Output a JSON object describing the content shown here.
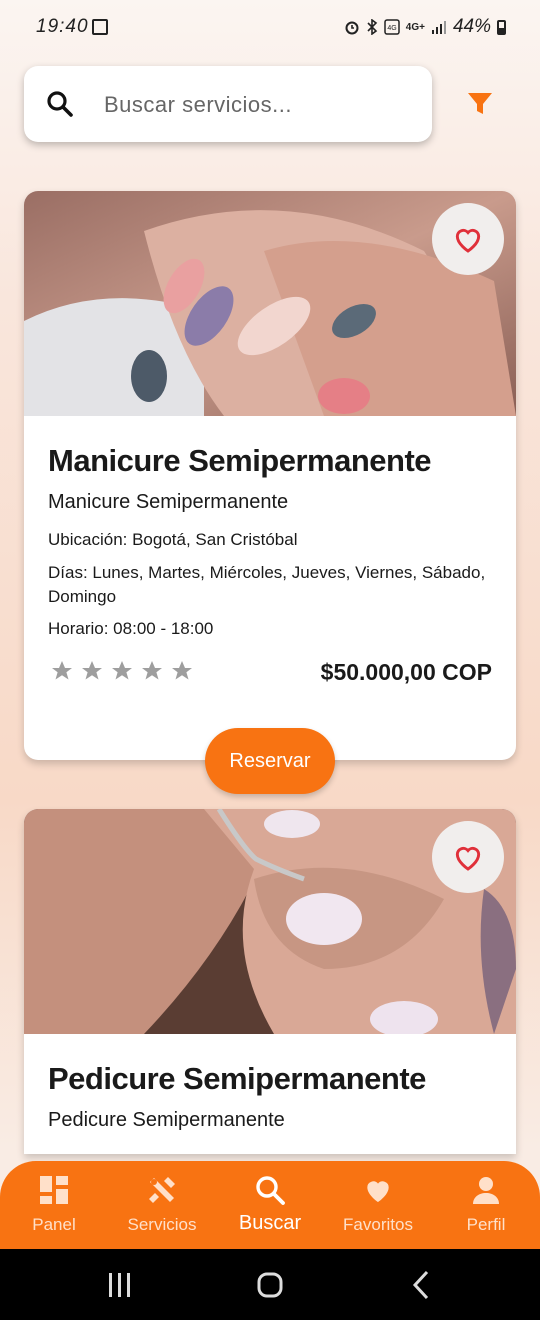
{
  "status_bar": {
    "time": "19:40",
    "network": "4G+",
    "battery": "44%"
  },
  "search": {
    "placeholder": "Buscar servicios..."
  },
  "colors": {
    "accent": "#f87312",
    "heart": "#e0303a",
    "star": "#9e9e9e"
  },
  "services": [
    {
      "title": "Manicure Semipermanente",
      "subtitle": "Manicure Semipermanente",
      "location": "Ubicación: Bogotá, San Cristóbal",
      "days": "Días: Lunes, Martes, Miércoles, Jueves, Viernes, Sábado, Domingo",
      "hours": "Horario: 08:00 - 18:00",
      "rating": 0,
      "price": "$50.000,00 COP",
      "reserve_label": "Reservar",
      "image_icon": "manicure-photo"
    },
    {
      "title": "Pedicure Semipermanente",
      "subtitle": "Pedicure Semipermanente",
      "image_icon": "pedicure-photo"
    }
  ],
  "bottom_nav": [
    {
      "label": "Panel",
      "icon": "dashboard-icon"
    },
    {
      "label": "Servicios",
      "icon": "tools-icon"
    },
    {
      "label": "Buscar",
      "icon": "search-icon",
      "active": true
    },
    {
      "label": "Favoritos",
      "icon": "heart-icon"
    },
    {
      "label": "Perfil",
      "icon": "person-icon"
    }
  ]
}
